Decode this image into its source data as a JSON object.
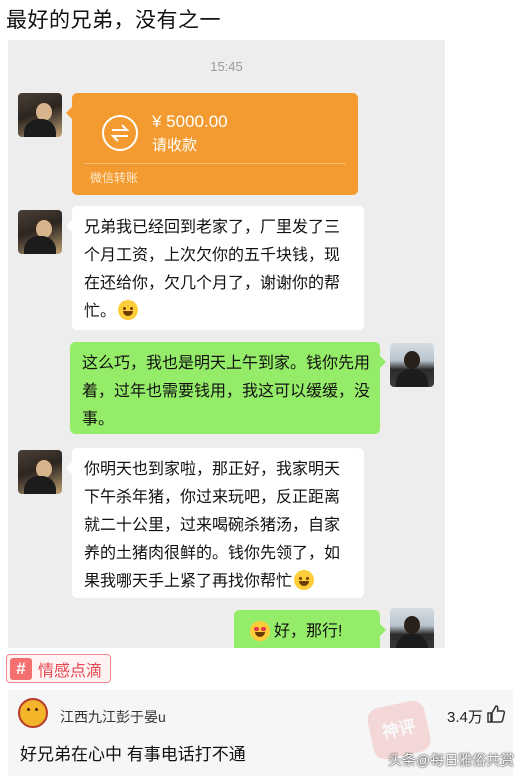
{
  "post": {
    "title": "最好的兄弟，没有之一"
  },
  "chat": {
    "time": "15:45",
    "transfer": {
      "amount": "¥ 5000.00",
      "status": "请收款",
      "footer": "微信转账"
    },
    "messages": [
      {
        "from": "friend",
        "text": "兄弟我已经回到老家了，厂里发了三个月工资，上次欠你的五千块钱，现在还给你，欠几个月了，谢谢你的帮忙。",
        "emoji": "laughing-emoji"
      },
      {
        "from": "me",
        "text": "这么巧，我也是明天上午到家。钱你先用着，过年也需要钱用，我这可以缓缓，没事。"
      },
      {
        "from": "friend",
        "text": "你明天也到家啦，那正好，我家明天下午杀年猪，你过来玩吧，反正距离就二十公里，过来喝碗杀猪汤，自家养的土猪肉很鲜的。钱你先领了，如果我哪天手上紧了再找你帮忙",
        "emoji": "grin-emoji"
      },
      {
        "from": "me",
        "text": "好，那行!",
        "emoji": "heart-eyes-emoji"
      }
    ]
  },
  "tag": {
    "icon": "#",
    "label": "情感点滴"
  },
  "comment": {
    "user": "江西九江彭于晏u",
    "likes": "3.4万",
    "text": "好兄弟在心中 有事电话打不通"
  },
  "stamp": {
    "text": "神评"
  },
  "watermark": "头条@每日雅俗共赏",
  "colors": {
    "transfer": "#f39b30",
    "my_bubble": "#95ec69",
    "chat_bg": "#ededed",
    "tag": "#e6454f"
  }
}
